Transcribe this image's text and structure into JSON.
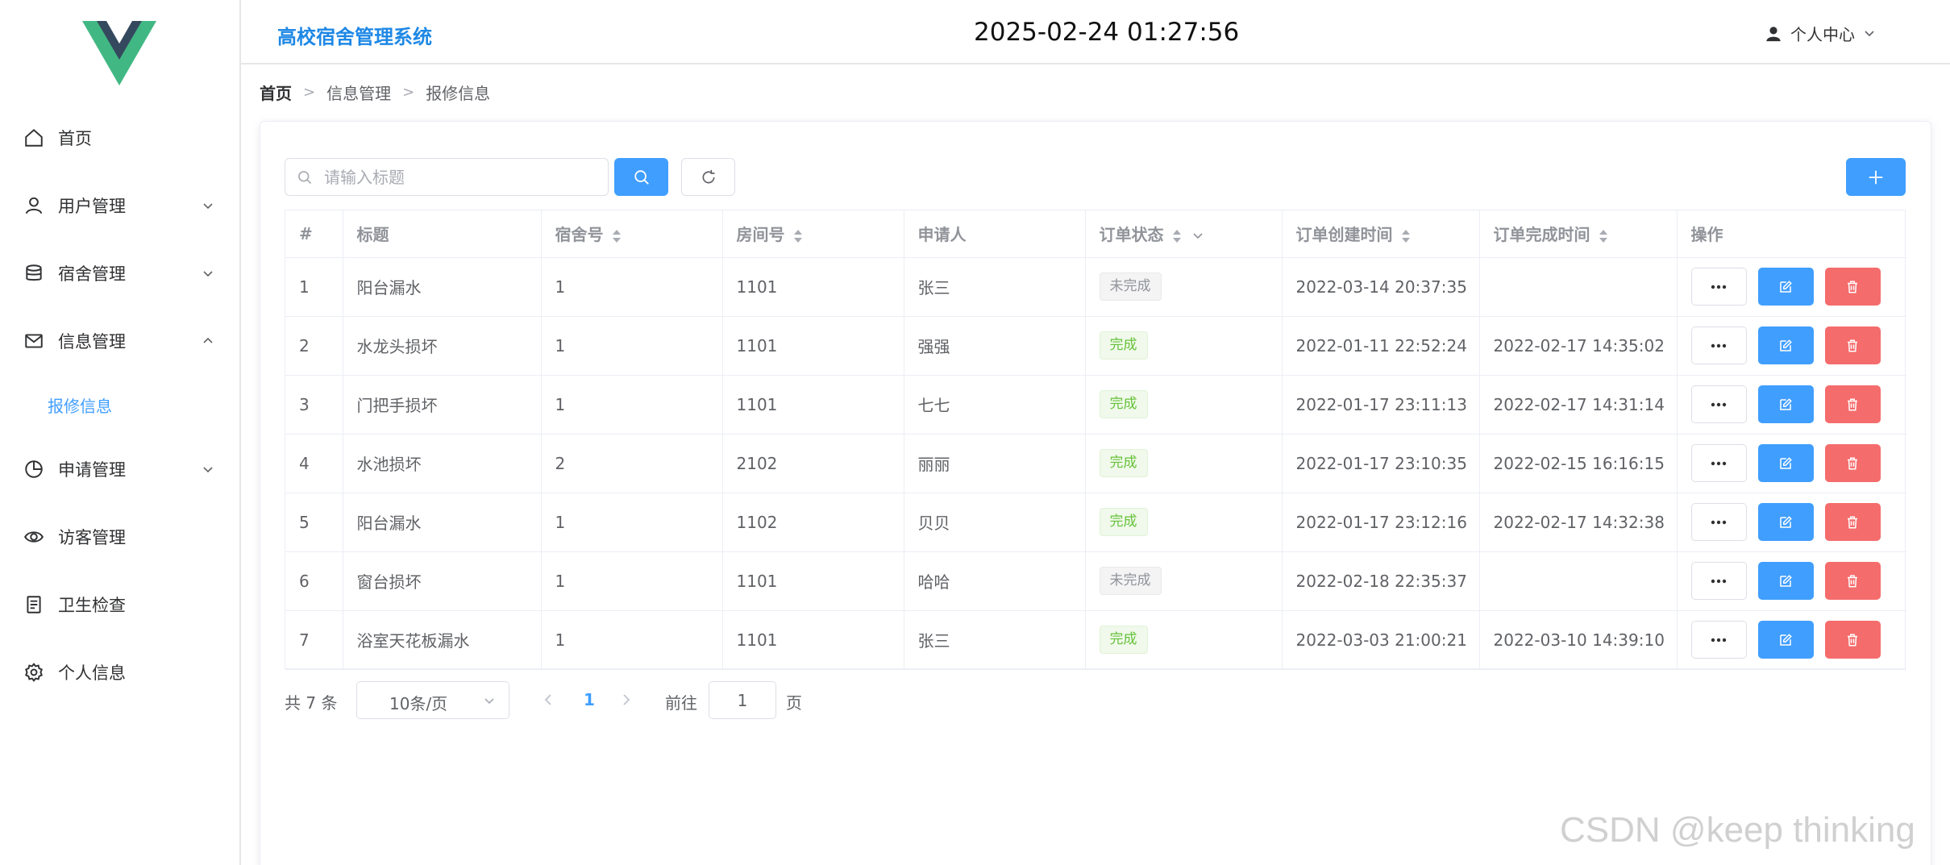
{
  "header": {
    "system_title": "高校宿舍管理系统",
    "clock": "2025-02-24 01:27:56",
    "user_center_label": "个人中心"
  },
  "sidebar": {
    "items": [
      {
        "label": "首页",
        "icon": "home-icon"
      },
      {
        "label": "用户管理",
        "icon": "user-icon",
        "expandable": true
      },
      {
        "label": "宿舍管理",
        "icon": "database-icon",
        "expandable": true
      },
      {
        "label": "信息管理",
        "icon": "message-icon",
        "expandable": true,
        "expanded": true
      },
      {
        "label": "报修信息",
        "active": true
      },
      {
        "label": "申请管理",
        "icon": "pie-chart-icon",
        "expandable": true
      },
      {
        "label": "访客管理",
        "icon": "eye-icon"
      },
      {
        "label": "卫生检查",
        "icon": "document-icon"
      },
      {
        "label": "个人信息",
        "icon": "gear-icon"
      }
    ]
  },
  "breadcrumb": [
    "首页",
    "信息管理",
    "报修信息"
  ],
  "search": {
    "placeholder": "请输入标题",
    "value": ""
  },
  "table": {
    "columns": [
      "#",
      "标题",
      "宿舍号",
      "房间号",
      "申请人",
      "订单状态",
      "订单创建时间",
      "订单完成时间",
      "操作"
    ],
    "rows": [
      {
        "no": "1",
        "title": "阳台漏水",
        "dorm": "1",
        "room": "1101",
        "applicant": "张三",
        "status": "未完成",
        "created": "2022-03-14 20:37:35",
        "finished": ""
      },
      {
        "no": "2",
        "title": "水龙头损坏",
        "dorm": "1",
        "room": "1101",
        "applicant": "强强",
        "status": "完成",
        "created": "2022-01-11 22:52:24",
        "finished": "2022-02-17 14:35:02"
      },
      {
        "no": "3",
        "title": "门把手损坏",
        "dorm": "1",
        "room": "1101",
        "applicant": "七七",
        "status": "完成",
        "created": "2022-01-17 23:11:13",
        "finished": "2022-02-17 14:31:14"
      },
      {
        "no": "4",
        "title": "水池损坏",
        "dorm": "2",
        "room": "2102",
        "applicant": "丽丽",
        "status": "完成",
        "created": "2022-01-17 23:10:35",
        "finished": "2022-02-15 16:16:15"
      },
      {
        "no": "5",
        "title": "阳台漏水",
        "dorm": "1",
        "room": "1102",
        "applicant": "贝贝",
        "status": "完成",
        "created": "2022-01-17 23:12:16",
        "finished": "2022-02-17 14:32:38"
      },
      {
        "no": "6",
        "title": "窗台损坏",
        "dorm": "1",
        "room": "1101",
        "applicant": "哈哈",
        "status": "未完成",
        "created": "2022-02-18 22:35:37",
        "finished": ""
      },
      {
        "no": "7",
        "title": "浴室天花板漏水",
        "dorm": "1",
        "room": "1101",
        "applicant": "张三",
        "status": "完成",
        "created": "2022-03-03 21:00:21",
        "finished": "2022-03-10 14:39:10"
      }
    ]
  },
  "pagination": {
    "total": "共 7 条",
    "page_size": "10条/页",
    "current_page": "1",
    "goto_label": "前往",
    "goto_value": "1",
    "unit": "页"
  },
  "watermark": "CSDN @keep   thinking",
  "colors": {
    "primary": "#409eff",
    "danger": "#f56c6c",
    "success": "#67c23a",
    "title_blue": "#1e88e5"
  }
}
